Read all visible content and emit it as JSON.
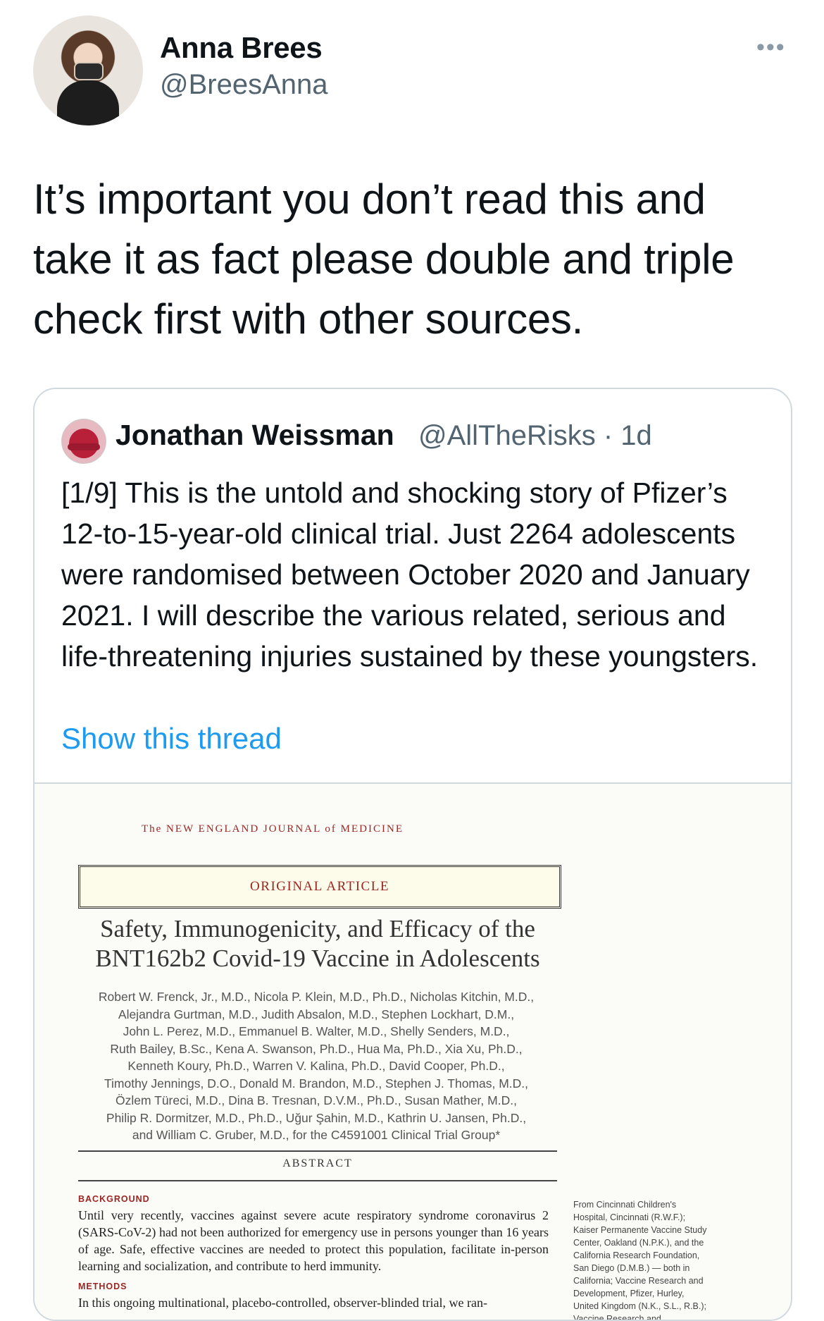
{
  "author": {
    "name": "Anna Brees",
    "handle": "@BreesAnna"
  },
  "more_label": "•••",
  "tweet_text": "It’s important you don’t read this and take it as fact please double and triple check first with other sources.",
  "quoted": {
    "name": "Jonathan Weissman",
    "handle": "@AllTheRisks · 1d",
    "text": "[1/9] This is the untold and shocking story of Pfizer’s 12-to-15-year-old clinical trial. Just 2264 adolescents were randomised between October 2020 and January 2021. I will describe the various related, serious and life-threatening injuries sustained by these youngsters.",
    "show_thread": "Show this thread"
  },
  "paper": {
    "journal": "The NEW ENGLAND JOURNAL of MEDICINE",
    "article_type": "ORIGINAL ARTICLE",
    "title": "Safety, Immunogenicity, and Efficacy of the BNT162b2 Covid-19 Vaccine in Adolescents",
    "authors": [
      "Robert W. Frenck, Jr., M.D., Nicola P. Klein, M.D., Ph.D., Nicholas Kitchin, M.D.,",
      "Alejandra Gurtman, M.D., Judith Absalon, M.D., Stephen Lockhart, D.M.,",
      "John L. Perez, M.D., Emmanuel B. Walter, M.D., Shelly Senders, M.D.,",
      "Ruth Bailey, B.Sc., Kena A. Swanson, Ph.D., Hua Ma, Ph.D., Xia Xu, Ph.D.,",
      "Kenneth Koury, Ph.D., Warren V. Kalina, Ph.D., David Cooper, Ph.D.,",
      "Timothy Jennings, D.O., Donald M. Brandon, M.D., Stephen J. Thomas, M.D.,",
      "Özlem Türeci, M.D., Dina B. Tresnan, D.V.M., Ph.D., Susan Mather, M.D.,",
      "Philip R. Dormitzer, M.D., Ph.D., Uğur Şahin, M.D., Kathrin U. Jansen, Ph.D.,",
      "and William C. Gruber, M.D., for the C4591001 Clinical Trial Group*"
    ],
    "abstract_label": "ABSTRACT",
    "background_head": "BACKGROUND",
    "background_text": "Until very recently, vaccines against severe acute respiratory syndrome coronavirus 2 (SARS-CoV-2) had not been authorized for emergency use in persons younger than 16 years of age. Safe, effective vaccines are needed to protect this population, facilitate in-person learning and socialization, and contribute to herd immunity.",
    "methods_head": "METHODS",
    "methods_text": "In this ongoing multinational, placebo-controlled, observer-blinded trial, we ran-",
    "side_note": "From Cincinnati Children's Hospital, Cincinnati (R.W.F.); Kaiser Permanente Vaccine Study Center, Oakland (N.P.K.), and the California Research Foundation, San Diego (D.M.B.) — both in California; Vaccine Research and Development, Pfizer, Hurley, United Kingdom (N.K., S.L., R.B.); Vaccine Research and Development, Pfizer, Pearl River (A.G., J.A., K.A.S., K.K.,"
  }
}
